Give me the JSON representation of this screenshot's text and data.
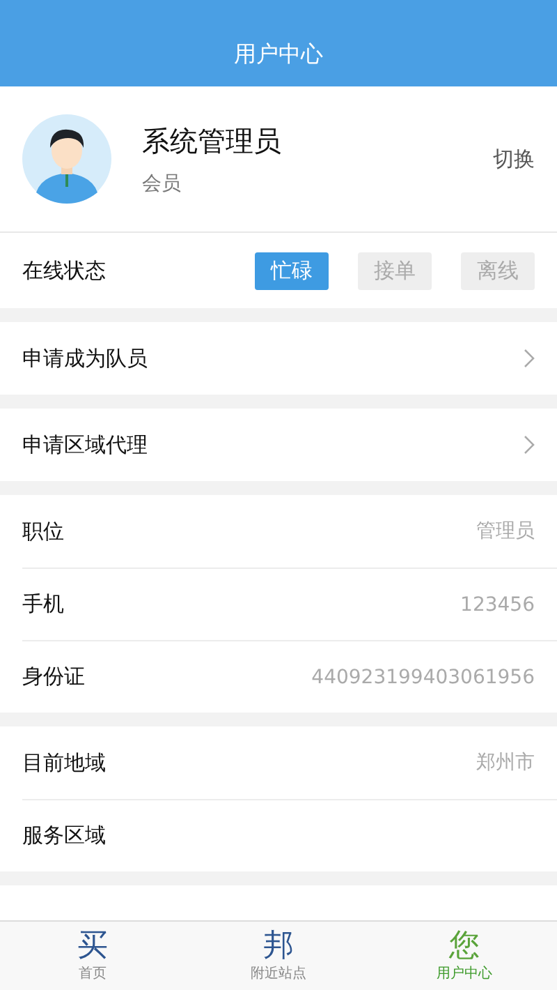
{
  "header": {
    "title": "用户中心"
  },
  "profile": {
    "name": "系统管理员",
    "role": "会员",
    "action": "切换"
  },
  "online_status": {
    "label": "在线状态",
    "options": [
      {
        "label": "忙碌",
        "selected": true
      },
      {
        "label": "接单",
        "selected": false
      },
      {
        "label": "离线",
        "selected": false
      }
    ]
  },
  "sections": [
    [
      {
        "label": "申请成为队员",
        "kind": "link"
      }
    ],
    [
      {
        "label": "申请区域代理",
        "kind": "link"
      }
    ],
    [
      {
        "label": "职位",
        "kind": "value",
        "value": "管理员"
      },
      {
        "label": "手机",
        "kind": "value",
        "value": "123456"
      },
      {
        "label": "身份证",
        "kind": "value",
        "value": "440923199403061956"
      }
    ],
    [
      {
        "label": "目前地域",
        "kind": "value",
        "value": "郑州市"
      },
      {
        "label": "服务区域",
        "kind": "value"
      }
    ]
  ],
  "tab_bar": [
    {
      "icon": "买",
      "label": "首页",
      "selected": false
    },
    {
      "icon": "邦",
      "label": "附近站点",
      "selected": false
    },
    {
      "icon": "您",
      "label": "用户中心",
      "selected": true
    }
  ]
}
